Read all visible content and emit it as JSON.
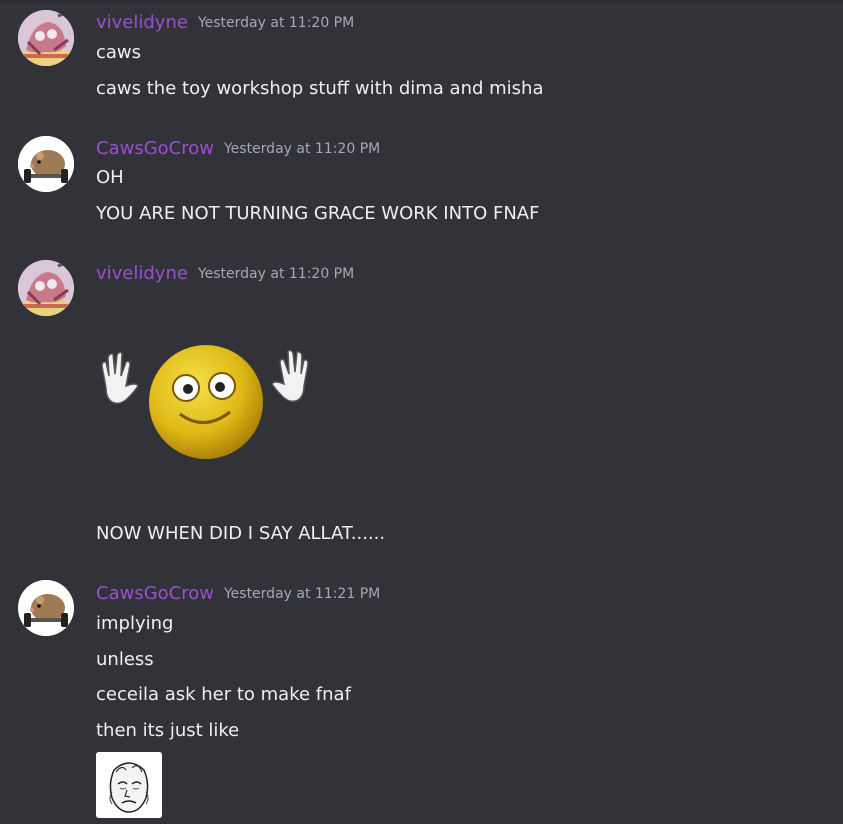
{
  "messages": [
    {
      "author": "vivelidyne",
      "timestamp": "Yesterday at 11:20 PM",
      "lines": [
        "caws",
        "caws the toy workshop stuff with dima and misha"
      ]
    },
    {
      "author": "CawsGoCrow",
      "timestamp": "Yesterday at 11:20 PM",
      "lines": [
        "OH",
        "YOU ARE NOT TURNING GRACE WORK INTO FNAF"
      ]
    },
    {
      "author": "vivelidyne",
      "timestamp": "Yesterday at 11:20 PM",
      "attachment": "waving-smiley-emoji",
      "lines": [
        "NOW WHEN DID I SAY ALLAT......"
      ]
    },
    {
      "author": "CawsGoCrow",
      "timestamp": "Yesterday at 11:21 PM",
      "lines": [
        "implying",
        "unless",
        "ceceila ask her to make fnaf",
        "then its just like"
      ],
      "attachment": "tired-face-meme-thumbnail"
    }
  ],
  "colors": {
    "background": "#313338",
    "username": "#9b4fd0",
    "timestamp": "#a7a9b0",
    "text": "#eeeff1"
  }
}
